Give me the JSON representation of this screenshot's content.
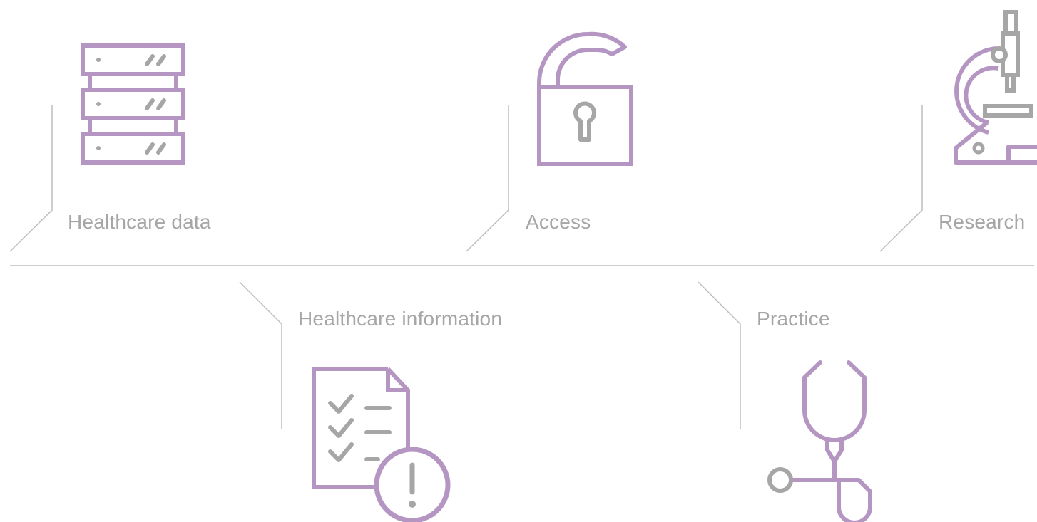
{
  "items": [
    {
      "label": "Healthcare data",
      "icon": "server-rack-icon"
    },
    {
      "label": "Access",
      "icon": "unlocked-padlock-icon"
    },
    {
      "label": "Research",
      "icon": "microscope-icon"
    },
    {
      "label": "Healthcare information",
      "icon": "checklist-document-alert-icon"
    },
    {
      "label": "Practice",
      "icon": "stethoscope-icon"
    }
  ],
  "colors": {
    "purple": "#b596c3",
    "gray": "#a6a6a6",
    "line": "#bdbdbd"
  }
}
